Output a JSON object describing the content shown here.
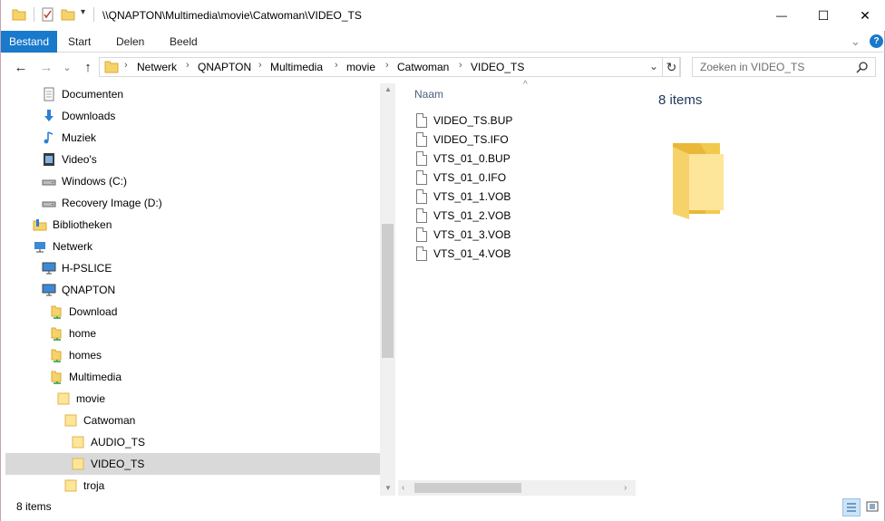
{
  "window": {
    "title": "\\\\QNAPTON\\Multimedia\\movie\\Catwoman\\VIDEO_TS",
    "minimize_glyph": "—",
    "maximize_glyph": "☐",
    "close_glyph": "✕"
  },
  "ribbon": {
    "tabs": [
      "Bestand",
      "Start",
      "Delen",
      "Beeld"
    ],
    "expand_glyph": "⌄",
    "help_glyph": "?"
  },
  "nav": {
    "back_glyph": "←",
    "forward_glyph": "→",
    "recent_glyph": "⌄",
    "up_glyph": "↑"
  },
  "address": {
    "crumbs": [
      "Netwerk",
      "QNAPTON",
      "Multimedia",
      "movie",
      "Catwoman",
      "VIDEO_TS"
    ],
    "separator": "›",
    "dropdown_glyph": "⌄",
    "refresh_glyph": "↻"
  },
  "search": {
    "placeholder": "Zoeken in VIDEO_TS"
  },
  "tree": [
    {
      "label": "Documenten",
      "icon": "documents-icon"
    },
    {
      "label": "Downloads",
      "icon": "downloads-icon"
    },
    {
      "label": "Muziek",
      "icon": "music-icon"
    },
    {
      "label": "Video's",
      "icon": "videos-icon"
    },
    {
      "label": "Windows (C:)",
      "icon": "drive-icon"
    },
    {
      "label": "Recovery Image (D:)",
      "icon": "drive-icon"
    },
    {
      "label": "Bibliotheken",
      "icon": "libraries-icon"
    },
    {
      "label": "Netwerk",
      "icon": "network-icon"
    },
    {
      "label": "H-PSLICE",
      "icon": "computer-icon"
    },
    {
      "label": "QNAPTON",
      "icon": "computer-icon"
    },
    {
      "label": "Download",
      "icon": "share-folder-icon"
    },
    {
      "label": "home",
      "icon": "share-folder-icon"
    },
    {
      "label": "homes",
      "icon": "share-folder-icon"
    },
    {
      "label": "Multimedia",
      "icon": "share-folder-icon"
    },
    {
      "label": "movie",
      "icon": "folder-icon"
    },
    {
      "label": "Catwoman",
      "icon": "folder-icon"
    },
    {
      "label": "AUDIO_TS",
      "icon": "folder-icon"
    },
    {
      "label": "VIDEO_TS",
      "icon": "folder-icon",
      "selected": true
    },
    {
      "label": "troja",
      "icon": "folder-icon"
    }
  ],
  "files": {
    "column_name": "Naam",
    "items": [
      "VIDEO_TS.BUP",
      "VIDEO_TS.IFO",
      "VTS_01_0.BUP",
      "VTS_01_0.IFO",
      "VTS_01_1.VOB",
      "VTS_01_2.VOB",
      "VTS_01_3.VOB",
      "VTS_01_4.VOB"
    ]
  },
  "preview": {
    "count_text": "8 items"
  },
  "statusbar": {
    "count_text": "8 items"
  },
  "colors": {
    "accent": "#1979ca",
    "folder": "#f6d36a",
    "selected_row": "#d9d9d9"
  }
}
